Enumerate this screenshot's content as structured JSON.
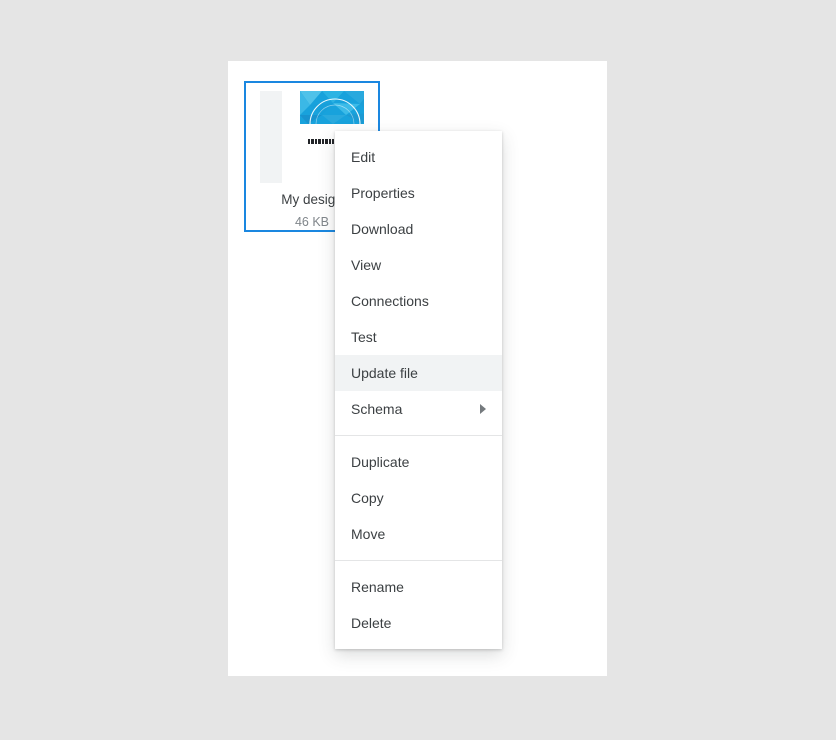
{
  "canvas": {
    "background_color": "#e5e5e5"
  },
  "panel": {
    "background_color": "#ffffff"
  },
  "file_card": {
    "name": "My design",
    "size": "46 KB",
    "selected": true,
    "selection_color": "#1a87e0",
    "thumbnail": {
      "icon": "document-thumbnail-icon",
      "description": "low-poly blue banner graphic with white arc and small heading text"
    }
  },
  "context_menu": {
    "highlighted_item": "Update file",
    "groups": [
      {
        "items": [
          {
            "label": "Edit",
            "icon": "menu-item-edit",
            "submenu": false
          },
          {
            "label": "Properties",
            "icon": "menu-item-properties",
            "submenu": false
          },
          {
            "label": "Download",
            "icon": "menu-item-download",
            "submenu": false
          },
          {
            "label": "View",
            "icon": "menu-item-view",
            "submenu": false
          },
          {
            "label": "Connections",
            "icon": "menu-item-connections",
            "submenu": false
          },
          {
            "label": "Test",
            "icon": "menu-item-test",
            "submenu": false
          },
          {
            "label": "Update file",
            "icon": "menu-item-update-file",
            "submenu": false
          },
          {
            "label": "Schema",
            "icon": "menu-item-schema",
            "submenu": true
          }
        ]
      },
      {
        "items": [
          {
            "label": "Duplicate",
            "icon": "menu-item-duplicate",
            "submenu": false
          },
          {
            "label": "Copy",
            "icon": "menu-item-copy",
            "submenu": false
          },
          {
            "label": "Move",
            "icon": "menu-item-move",
            "submenu": false
          }
        ]
      },
      {
        "items": [
          {
            "label": "Rename",
            "icon": "menu-item-rename",
            "submenu": false
          },
          {
            "label": "Delete",
            "icon": "menu-item-delete",
            "submenu": false
          }
        ]
      }
    ]
  },
  "colors": {
    "accent": "#1a87e0",
    "text_primary": "#3c4043",
    "text_secondary": "#80868b",
    "highlight_row": "#f1f3f4",
    "divider": "#e4e5e6"
  }
}
